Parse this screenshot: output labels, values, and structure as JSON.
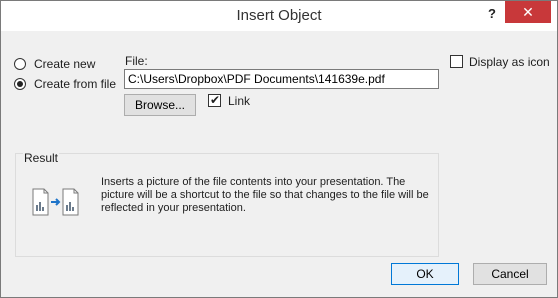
{
  "window": {
    "title": "Insert Object",
    "help_label": "?",
    "close_label": "✕"
  },
  "source": {
    "create_new_label": "Create new",
    "create_new_accel": "n",
    "create_from_file_label": "Create from file",
    "create_from_file_accel": "l",
    "selected": "create_from_file"
  },
  "file": {
    "label": "File:",
    "path_value": "C:\\Users\\Dropbox\\PDF Documents\\141639e.pdf",
    "browse_label": "Browse...",
    "link_label": "Link",
    "link_checked": true
  },
  "display_as_icon": {
    "label": "Display as icon",
    "checked": false
  },
  "result": {
    "heading": "Result",
    "description": "Inserts a picture of the file contents into your presentation. The picture will be a shortcut to the file so that changes to the file will be reflected in your presentation.",
    "icon": "linked-file-icon"
  },
  "buttons": {
    "ok_label": "OK",
    "cancel_label": "Cancel"
  },
  "colors": {
    "close_bg": "#c8383a",
    "dialog_bg": "#f0f0f0",
    "ok_border": "#0078d7",
    "arrow": "#1e74c9"
  }
}
